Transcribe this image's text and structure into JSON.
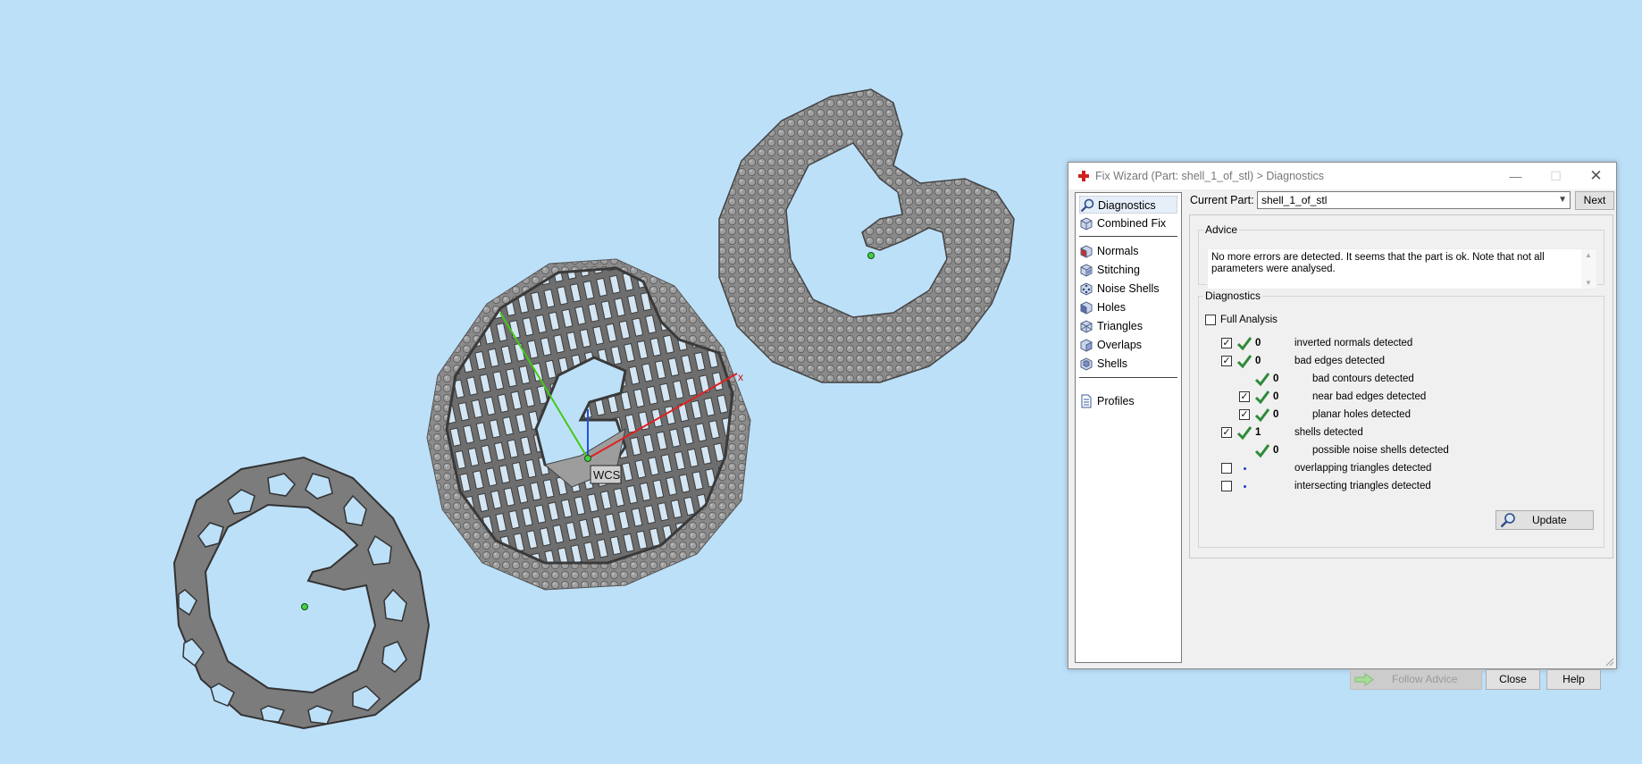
{
  "window": {
    "title": "Fix Wizard (Part: shell_1_of_stl) > Diagnostics",
    "min_glyph": "—",
    "max_glyph": "☐",
    "close_glyph": "✕"
  },
  "viewport": {
    "wcs_label": "WCS",
    "axis_x_label": "x"
  },
  "sidebar": {
    "items": [
      {
        "label": "Diagnostics",
        "icon": "magnifier-icon",
        "selected": true
      },
      {
        "label": "Combined Fix",
        "icon": "cube-icon"
      },
      {
        "label": "Normals",
        "icon": "cube-red-face-icon"
      },
      {
        "label": "Stitching",
        "icon": "cube-stitch-icon"
      },
      {
        "label": "Noise Shells",
        "icon": "cube-dots-icon"
      },
      {
        "label": "Holes",
        "icon": "cube-hole-icon"
      },
      {
        "label": "Triangles",
        "icon": "cube-triangles-icon"
      },
      {
        "label": "Overlaps",
        "icon": "cube-overlap-icon"
      },
      {
        "label": "Shells",
        "icon": "cube-shells-icon"
      },
      {
        "label": "Profiles",
        "icon": "document-icon"
      }
    ]
  },
  "current_part": {
    "label": "Current Part:",
    "value": "shell_1_of_stl",
    "next_label": "Next"
  },
  "advice": {
    "legend": "Advice",
    "text": "No more errors are detected. It seems that the part is ok. Note that not all parameters were analysed."
  },
  "diagnostics": {
    "legend": "Diagnostics",
    "full_analysis": {
      "label": "Full Analysis",
      "checked": false
    },
    "rows": [
      {
        "checkbox": true,
        "checked": true,
        "status": "ok",
        "count": "0",
        "label": "inverted normals detected",
        "indent": 0
      },
      {
        "checkbox": true,
        "checked": true,
        "status": "ok",
        "count": "0",
        "label": "bad edges detected",
        "indent": 0
      },
      {
        "checkbox": false,
        "checked": false,
        "status": "ok",
        "count": "0",
        "label": "bad contours detected",
        "indent": 1
      },
      {
        "checkbox": true,
        "checked": true,
        "status": "ok",
        "count": "0",
        "label": "near bad edges detected",
        "indent": 1
      },
      {
        "checkbox": true,
        "checked": true,
        "status": "ok",
        "count": "0",
        "label": "planar holes detected",
        "indent": 1
      },
      {
        "checkbox": true,
        "checked": true,
        "status": "ok",
        "count": "1",
        "label": "shells detected",
        "indent": 0
      },
      {
        "checkbox": false,
        "checked": false,
        "status": "ok",
        "count": "0",
        "label": "possible noise shells detected",
        "indent": 1
      },
      {
        "checkbox": true,
        "checked": false,
        "status": "not-analysed",
        "count": "",
        "label": "overlapping triangles detected",
        "indent": 0
      },
      {
        "checkbox": true,
        "checked": false,
        "status": "not-analysed",
        "count": "",
        "label": "intersecting triangles detected",
        "indent": 0
      }
    ],
    "update_label": "Update"
  },
  "buttons": {
    "follow_advice": "Follow Advice",
    "close": "Close",
    "help": "Help"
  },
  "colors": {
    "viewport_bg": "#bde0f9",
    "model_gray": "#7d7d7d",
    "check_green": "#2f8a3a",
    "axis_x": "#e02020",
    "axis_y": "#43c818",
    "axis_z": "#2050e0",
    "title_icon_red": "#d21f1f"
  }
}
